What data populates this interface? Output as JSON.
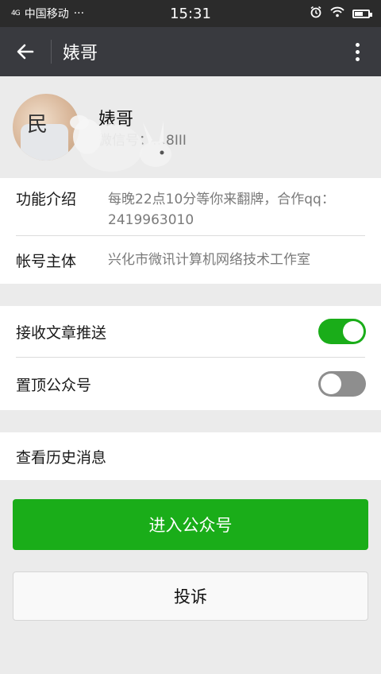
{
  "status_bar": {
    "signal": "4G",
    "carrier": "中国移动",
    "dots": "···",
    "time": "15:31",
    "alarm_icon": "alarm-icon",
    "wifi_icon": "wifi-icon",
    "battery_level": 0.6
  },
  "appbar": {
    "back_icon": "arrow-left-icon",
    "title": "婊哥",
    "more_icon": "more-vertical-icon"
  },
  "profile": {
    "avatar_text": "民",
    "name": "婊哥",
    "wechat_id": "微信号：…8III"
  },
  "info": {
    "intro_label": "功能介绍",
    "intro_value": "每晚22点10分等你来翻牌，合作qq：2419963010",
    "owner_label": "帐号主体",
    "owner_value": "兴化市微讯计算机网络技术工作室"
  },
  "settings": {
    "push_label": "接收文章推送",
    "push_on": true,
    "pin_label": "置顶公众号",
    "pin_on": false
  },
  "history": {
    "label": "查看历史消息"
  },
  "actions": {
    "enter_label": "进入公众号",
    "report_label": "投诉"
  },
  "colors": {
    "accent": "#1aad19",
    "appbar": "#393a3f",
    "statusbar": "#2b2b2b"
  }
}
